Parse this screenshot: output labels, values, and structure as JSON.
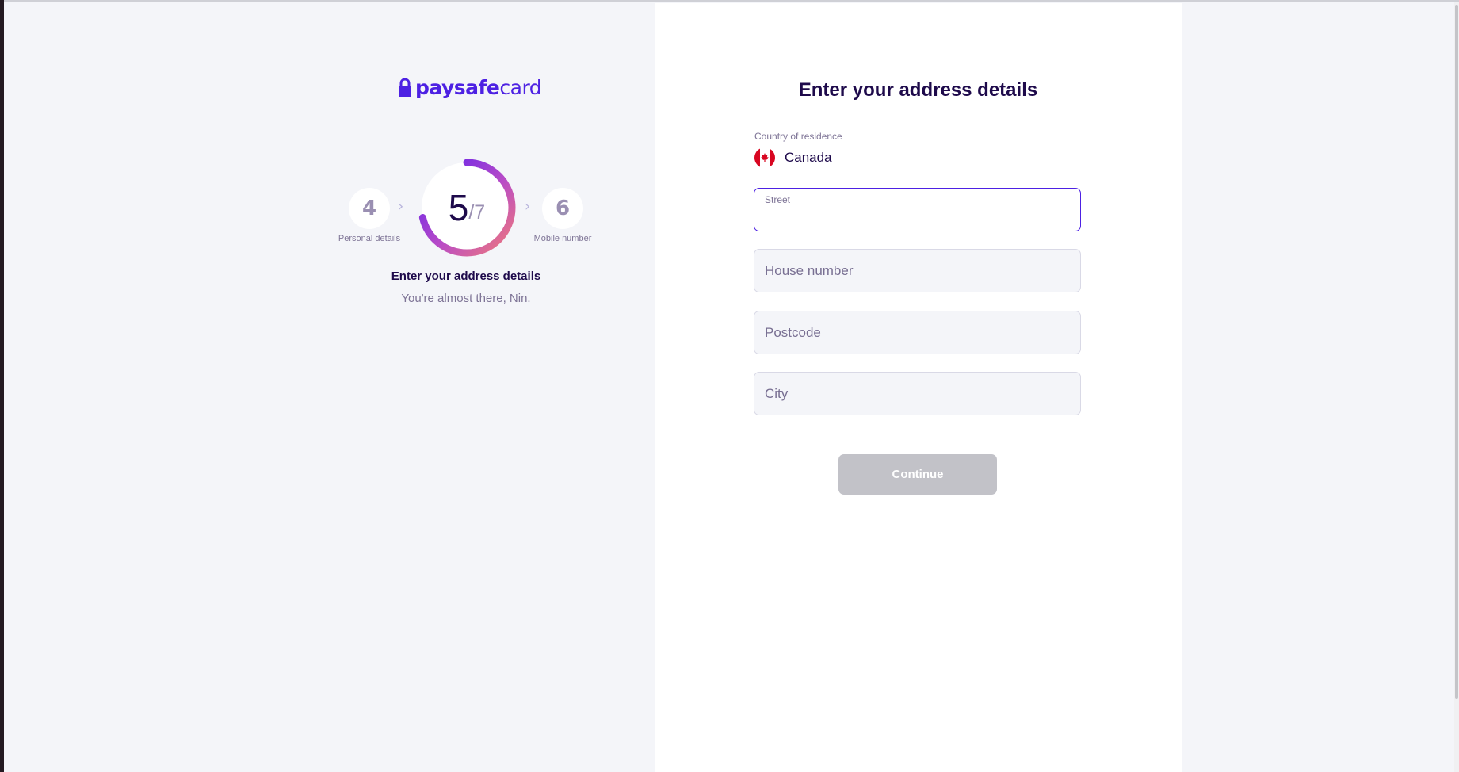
{
  "brand": {
    "logo_bold": "paysafe",
    "logo_thin": "card",
    "color": "#4d21e3"
  },
  "stepper": {
    "previous": {
      "number": "4",
      "label": "Personal details"
    },
    "current": {
      "number": "5",
      "total": "/7",
      "progress": 0.714
    },
    "next": {
      "number": "6",
      "label": "Mobile number"
    }
  },
  "left": {
    "title": "Enter your address details",
    "subtitle": "You're almost there, Nin."
  },
  "form": {
    "title": "Enter your address details",
    "country": {
      "label": "Country of residence",
      "value": "Canada",
      "flag_icon": "canada-flag-icon"
    },
    "street": {
      "label": "Street",
      "value": ""
    },
    "house_number": {
      "placeholder": "House number"
    },
    "postcode": {
      "placeholder": "Postcode"
    },
    "city": {
      "placeholder": "City"
    },
    "continue_label": "Continue"
  },
  "colors": {
    "accent": "#4d21e3",
    "heading": "#1e0a4b",
    "muted": "#7e7496",
    "disabled_button": "#c2c2c8"
  }
}
